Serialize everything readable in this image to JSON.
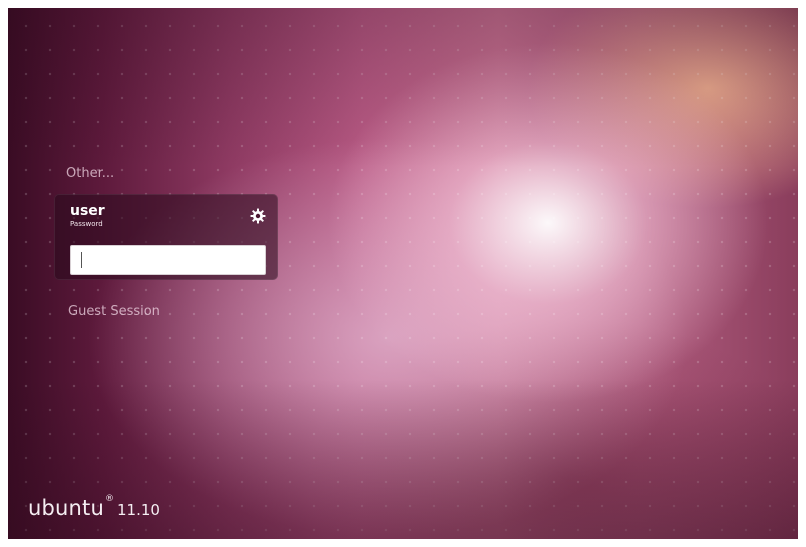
{
  "login": {
    "other_label": "Other...",
    "user_card": {
      "username": "user",
      "password_label": "Password",
      "password_value": "",
      "settings_icon": "gear-icon"
    },
    "guest_label": "Guest Session"
  },
  "branding": {
    "logo_text": "ubuntu",
    "registered_mark": "®",
    "version": "11.10"
  },
  "colors": {
    "background_primary": "#8e3a62",
    "background_dark": "#3a0c24",
    "text_light": "#f5eef2",
    "input_background": "#ffffff"
  }
}
